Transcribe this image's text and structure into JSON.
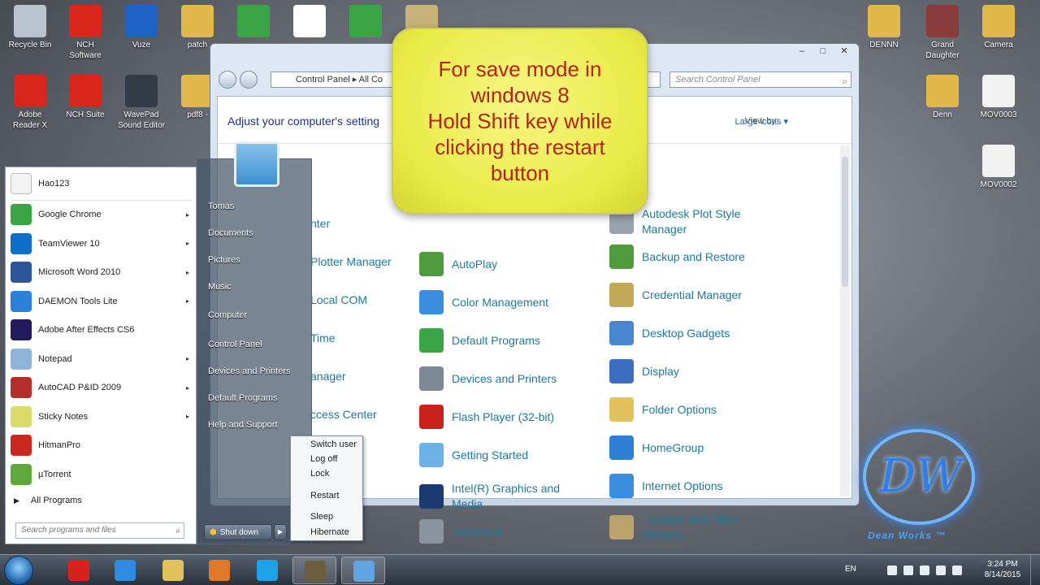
{
  "desktop": {
    "icons_left": [
      {
        "label": "Recycle Bin",
        "color": "#b9c4cf"
      },
      {
        "label": "NCH\nSoftware",
        "color": "#d9261c"
      },
      {
        "label": "Vuze",
        "color": "#1d62c4"
      },
      {
        "label": "patch",
        "color": "#e0b94a"
      },
      {
        "label": "",
        "color": "#3aa547"
      },
      {
        "label": "",
        "color": "#ffffff"
      },
      {
        "label": "",
        "color": "#3aa547"
      },
      {
        "label": "",
        "color": "#c9b27a"
      },
      {
        "label": "Adobe\nReader X",
        "color": "#d9261c"
      },
      {
        "label": "NCH Suite",
        "color": "#d9261c"
      },
      {
        "label": "WavePad\nSound Editor",
        "color": "#333b47"
      },
      {
        "label": "pdf8 -",
        "color": "#e0b94a"
      }
    ],
    "icons_right": [
      {
        "label": "DENNN",
        "color": "#e0b94a"
      },
      {
        "label": "Grand\nDaughter",
        "color": "#8a3b3b"
      },
      {
        "label": "Camera",
        "color": "#e0b94a"
      },
      {
        "label": "Denn",
        "color": "#e0b94a"
      },
      {
        "label": "MOV0003",
        "color": "#f2f2f2"
      },
      {
        "label": "MOV0002",
        "color": "#f2f2f2"
      }
    ]
  },
  "control_panel": {
    "breadcrumb": "Control Panel  ▸  All Co",
    "search_placeholder": "Search Control Panel",
    "heading": "Adjust your computer's setting",
    "view_by_label": "View by:",
    "view_by_value": "Large icons ▾",
    "col1": [
      {
        "label": "nter"
      },
      {
        "label": "Plotter Manager"
      },
      {
        "label": "Local COM"
      },
      {
        "label": "Time"
      },
      {
        "label": "anager"
      },
      {
        "label": "ccess Center"
      }
    ],
    "col2": [
      {
        "label": "AutoPlay",
        "color": "#4f9a3c"
      },
      {
        "label": "Color Management",
        "color": "#3b8de0"
      },
      {
        "label": "Default Programs",
        "color": "#3aa547"
      },
      {
        "label": "Devices and Printers",
        "color": "#7d8896"
      },
      {
        "label": "Flash Player (32-bit)",
        "color": "#c8201a"
      },
      {
        "label": "Getting Started",
        "color": "#6cb2e6"
      },
      {
        "label": "Intel(R) Graphics and\nMedia",
        "color": "#1b3a72"
      },
      {
        "label": "Keyboard",
        "color": "#8a939e"
      }
    ],
    "col3": [
      {
        "label": "Autodesk Plot Style\nManager",
        "color": "#9aa3ad"
      },
      {
        "label": "Backup and Restore",
        "color": "#4f9a3c"
      },
      {
        "label": "Credential Manager",
        "color": "#c2a857"
      },
      {
        "label": "Desktop Gadgets",
        "color": "#4a86cf"
      },
      {
        "label": "Display",
        "color": "#3b6ec0"
      },
      {
        "label": "Folder Options",
        "color": "#e2c25c"
      },
      {
        "label": "HomeGroup",
        "color": "#2f7fd6"
      },
      {
        "label": "Internet Options",
        "color": "#3b8de0"
      },
      {
        "label": "Location and Other\nSensors",
        "color": "#b9a36a"
      }
    ]
  },
  "note": {
    "text": "For save mode in\nwindows 8\nHold Shift key while\nclicking the restart\nbutton"
  },
  "start_menu": {
    "pinned": "Hao123",
    "programs": [
      {
        "label": "Google Chrome",
        "color": "#3aa547",
        "arrow": "▸"
      },
      {
        "label": "TeamViewer 10",
        "color": "#0e6fc9",
        "arrow": "▸"
      },
      {
        "label": "Microsoft Word 2010",
        "color": "#2b579a",
        "arrow": "▸"
      },
      {
        "label": "DAEMON Tools Lite",
        "color": "#2d80d8",
        "arrow": "▸"
      },
      {
        "label": "Adobe After Effects CS6",
        "color": "#241a5e",
        "arrow": ""
      },
      {
        "label": "Notepad",
        "color": "#8fb3d9",
        "arrow": "▸"
      },
      {
        "label": "AutoCAD P&ID 2009",
        "color": "#b52f2a",
        "arrow": "▸"
      },
      {
        "label": "Sticky Notes",
        "color": "#d9dc6a",
        "arrow": "▸"
      },
      {
        "label": "HitmanPro",
        "color": "#c8281e",
        "arrow": ""
      },
      {
        "label": "µTorrent",
        "color": "#5fa83b",
        "arrow": ""
      }
    ],
    "all_programs": "All Programs",
    "search_placeholder": "Search programs and files",
    "right_links": [
      "Tomas",
      "Documents",
      "Pictures",
      "Music",
      "Computer",
      "Control Panel",
      "Devices and Printers",
      "Default Programs",
      "Help and Support"
    ],
    "shutdown_label": "Shut down",
    "submenu": [
      "Switch user",
      "Log off",
      "Lock",
      "Restart",
      "Sleep",
      "Hibernate"
    ]
  },
  "logo": {
    "letters": "DW",
    "tagline": "Dean Works ™"
  },
  "taskbar": {
    "apps": [
      {
        "name": "opera",
        "color": "#d8231c"
      },
      {
        "name": "internet-explorer",
        "color": "#2f8be0"
      },
      {
        "name": "file-explorer",
        "color": "#e2c25c"
      },
      {
        "name": "media-player",
        "color": "#e07a2a"
      },
      {
        "name": "skype",
        "color": "#1fa3e8"
      },
      {
        "name": "game-app",
        "color": "#6b5e3e"
      },
      {
        "name": "control-panel",
        "color": "#5fa3e0"
      }
    ],
    "lang": "EN",
    "time": "3:24 PM",
    "date": "8/14/2015"
  }
}
